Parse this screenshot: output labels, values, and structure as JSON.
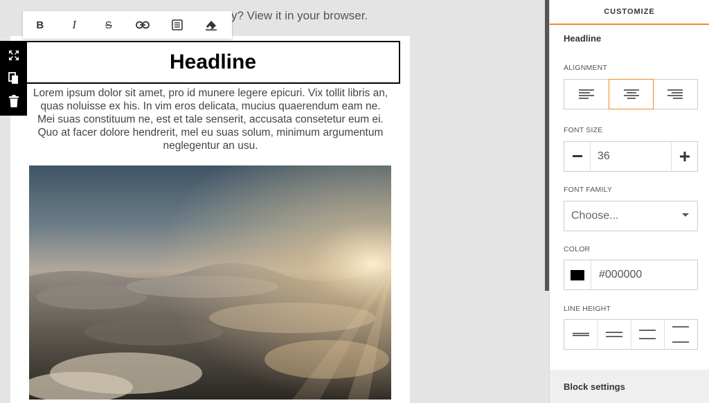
{
  "email": {
    "browser_note": "y? View it in your browser.",
    "headline": "Headline",
    "body": "Lorem ipsum dolor sit amet, pro id munere legere epicuri. Vix tollit libris an, quas noluisse ex his. In vim eros delicata, mucius quaerendum eam ne. Mei suas constituum ne, est et tale senserit, accusata consetetur eum ei. Quo at facer dolore hendrerit, mel eu suas solum, minimum argumentum neglegentur an usu."
  },
  "toolbar": {
    "items": [
      {
        "name": "bold",
        "label": "B"
      },
      {
        "name": "italic",
        "label": "I"
      },
      {
        "name": "strikethrough",
        "label": "S"
      },
      {
        "name": "link",
        "icon": "link-icon"
      },
      {
        "name": "paragraph",
        "icon": "paragraph-icon"
      },
      {
        "name": "clear-format",
        "icon": "eraser-icon"
      }
    ]
  },
  "side_tools": [
    "move-icon",
    "copy-icon",
    "trash-icon"
  ],
  "panel": {
    "header": "CUSTOMIZE",
    "section_title": "Headline",
    "alignment_label": "ALIGNMENT",
    "alignment_selected": "center",
    "font_size_label": "FONT SIZE",
    "font_size_value": "36",
    "font_family_label": "FONT FAMILY",
    "font_family_placeholder": "Choose...",
    "color_label": "COLOR",
    "color_value": "#000000",
    "line_height_label": "LINE HEIGHT",
    "block_settings": "Block settings"
  },
  "colors": {
    "accent": "#f08a24",
    "swatch": "#000000"
  }
}
